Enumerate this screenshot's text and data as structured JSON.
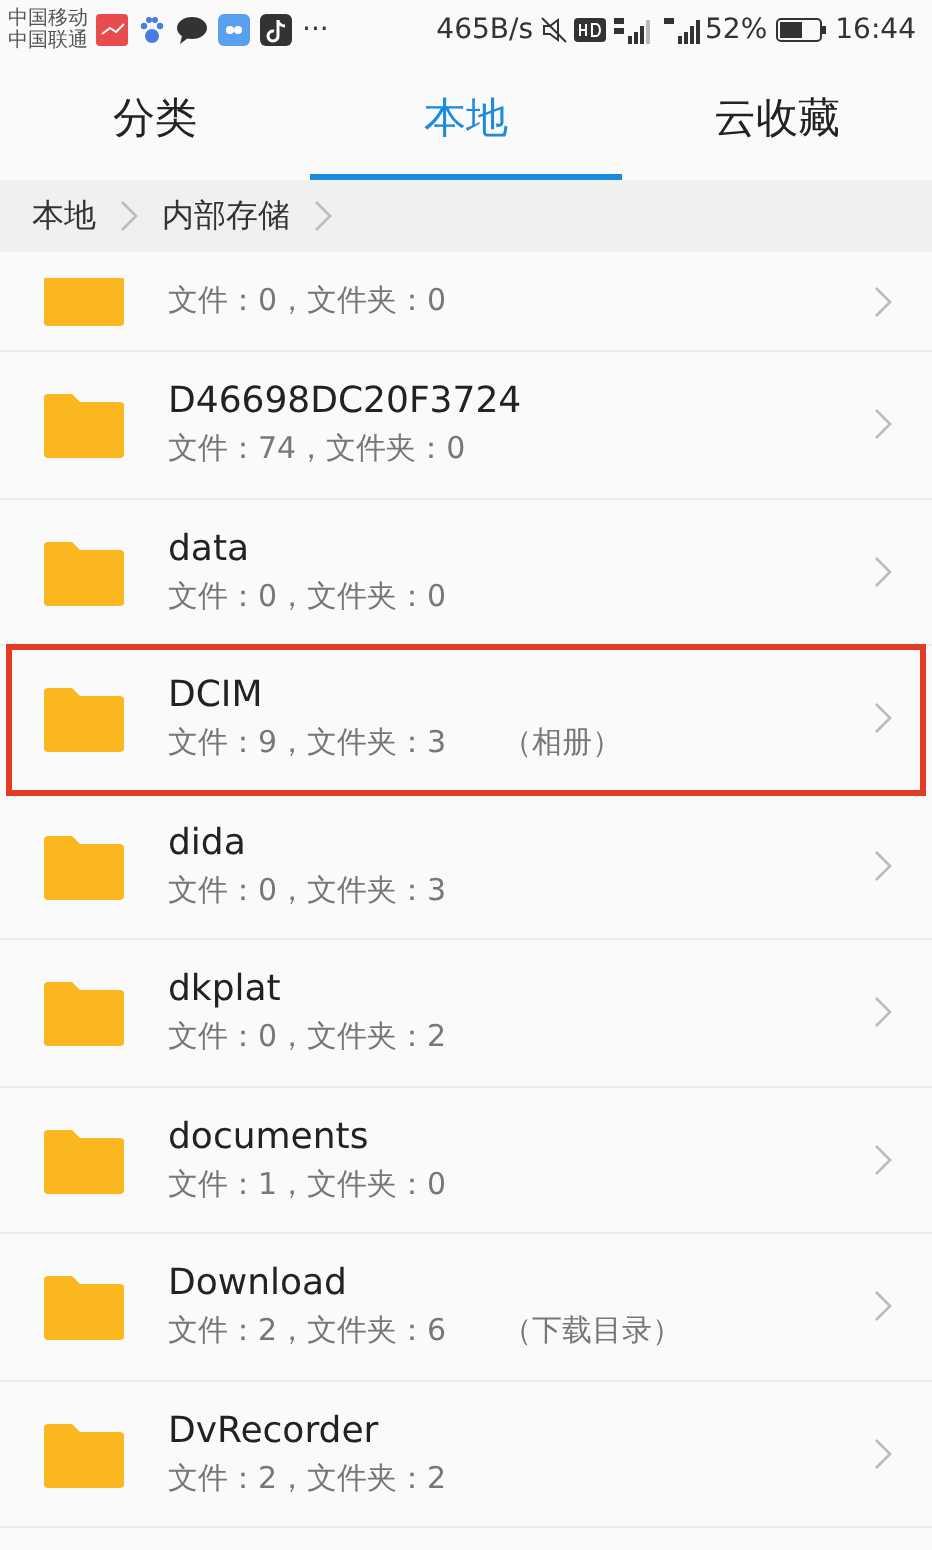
{
  "status_bar": {
    "carriers": [
      "中国移动",
      "中国联通"
    ],
    "more": "···",
    "speed": "465B/s",
    "battery": "52%",
    "time": "16:44"
  },
  "tabs": [
    {
      "label": "分类",
      "selected": false
    },
    {
      "label": "本地",
      "selected": true
    },
    {
      "label": "云收藏",
      "selected": false
    }
  ],
  "breadcrumb": [
    "本地",
    "内部存储"
  ],
  "files": [
    {
      "info": "文件：0，文件夹：0",
      "highlighted": false
    },
    {
      "name": "D46698DC20F3724",
      "info": "文件：74，文件夹：0",
      "highlighted": false
    },
    {
      "name": "data",
      "info": "文件：0，文件夹：0",
      "highlighted": false
    },
    {
      "name": "DCIM",
      "info": "文件：9，文件夹：3",
      "note": "（相册）",
      "highlighted": true
    },
    {
      "name": "dida",
      "info": "文件：0，文件夹：3",
      "highlighted": false
    },
    {
      "name": "dkplat",
      "info": "文件：0，文件夹：2",
      "highlighted": false
    },
    {
      "name": "documents",
      "info": "文件：1，文件夹：0",
      "highlighted": false
    },
    {
      "name": "Download",
      "info": "文件：2，文件夹：6",
      "note": "（下载目录）",
      "highlighted": false
    },
    {
      "name": "DvRecorder",
      "info": "文件：2，文件夹：2",
      "highlighted": false
    }
  ]
}
